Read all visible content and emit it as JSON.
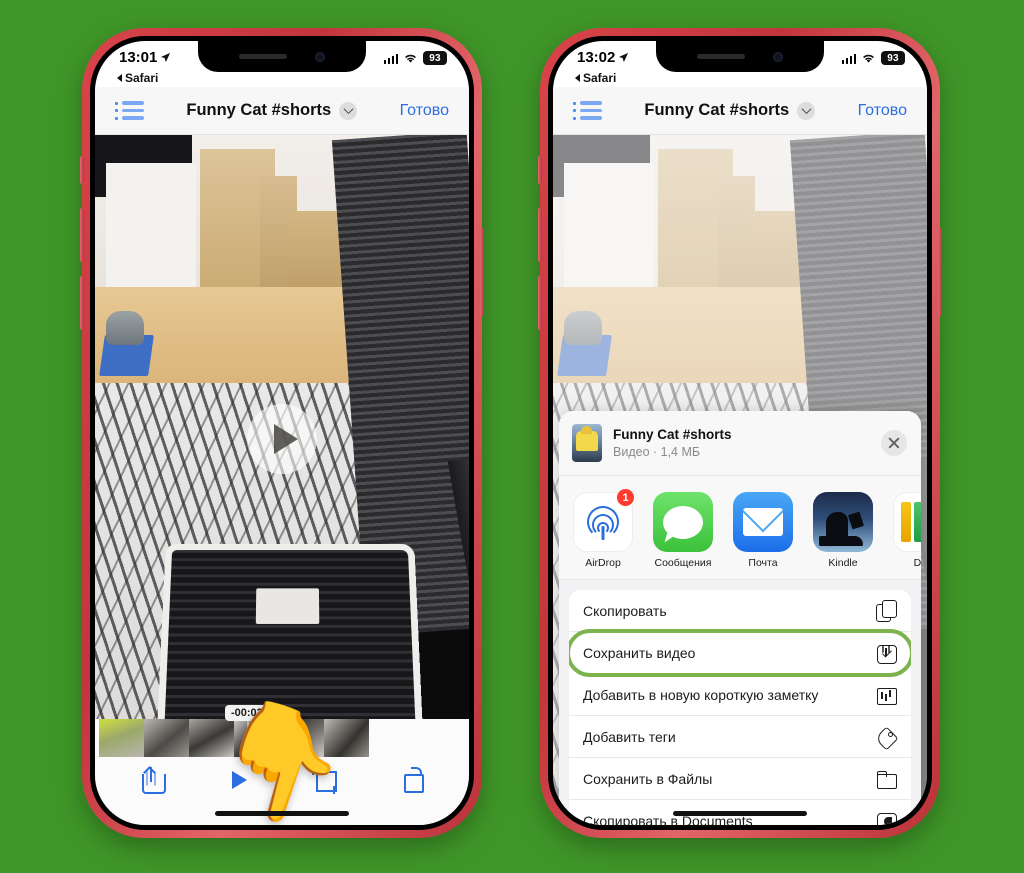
{
  "background_color": "#3f9628",
  "phones": [
    {
      "id": "left",
      "status_bar": {
        "time": "13:01",
        "location_icon": "location-arrow-icon",
        "signal_icon": "cellular-signal-icon",
        "wifi_icon": "wifi-icon",
        "battery": "93"
      },
      "back_link": "Safari",
      "nav": {
        "list_icon": "bulleted-list-icon",
        "title": "Funny Cat #shorts",
        "chevron_icon": "chevron-down-icon",
        "done_label": "Готово"
      },
      "player": {
        "play_overlay_icon": "play-icon",
        "time_remaining": "-00:02",
        "tools": [
          {
            "name": "share-button",
            "icon": "share-icon"
          },
          {
            "name": "play-button",
            "icon": "play-icon"
          },
          {
            "name": "crop-button",
            "icon": "crop-icon"
          },
          {
            "name": "rotate-button",
            "icon": "rotate-icon"
          }
        ]
      },
      "pointer_emoji": "👇"
    },
    {
      "id": "right",
      "status_bar": {
        "time": "13:02",
        "location_icon": "location-arrow-icon",
        "signal_icon": "cellular-signal-icon",
        "wifi_icon": "wifi-icon",
        "battery": "93"
      },
      "back_link": "Safari",
      "nav": {
        "list_icon": "bulleted-list-icon",
        "title": "Funny Cat #shorts",
        "chevron_icon": "chevron-down-icon",
        "done_label": "Готово"
      },
      "share_sheet": {
        "header": {
          "title": "Funny Cat #shorts",
          "subtitle": "Видео · 1,4 МБ",
          "close_icon": "close-icon"
        },
        "apps": [
          {
            "label": "AirDrop",
            "icon": "airdrop-icon",
            "badge": "1"
          },
          {
            "label": "Сообщения",
            "icon": "messages-icon",
            "badge": ""
          },
          {
            "label": "Почта",
            "icon": "mail-icon",
            "badge": ""
          },
          {
            "label": "Kindle",
            "icon": "kindle-icon",
            "badge": ""
          },
          {
            "label": "Doc",
            "icon": "documents-icon",
            "badge": ""
          }
        ],
        "actions": [
          {
            "label": "Скопировать",
            "icon": "copy-icon",
            "highlighted": false
          },
          {
            "label": "Сохранить видео",
            "icon": "save-video-icon",
            "highlighted": true
          },
          {
            "label": "Добавить в новую короткую заметку",
            "icon": "quick-note-icon",
            "highlighted": false
          },
          {
            "label": "Добавить теги",
            "icon": "tag-icon",
            "highlighted": false
          },
          {
            "label": "Сохранить в Файлы",
            "icon": "folder-icon",
            "highlighted": false
          },
          {
            "label": "Скопировать в Documents",
            "icon": "documents-app-icon",
            "highlighted": false
          }
        ],
        "highlight_color": "#7cb34f"
      }
    }
  ]
}
